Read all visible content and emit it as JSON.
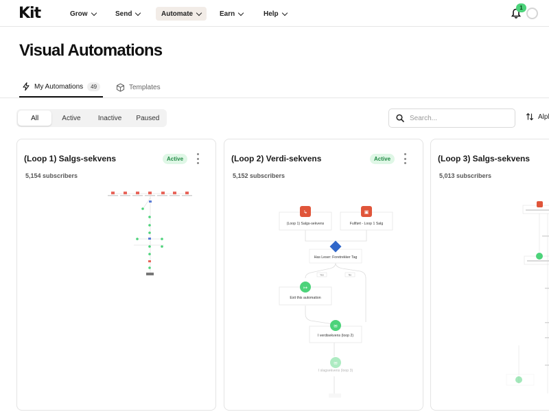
{
  "nav": {
    "logo": "Kit",
    "items": [
      {
        "label": "Grow"
      },
      {
        "label": "Send"
      },
      {
        "label": "Automate"
      },
      {
        "label": "Earn"
      },
      {
        "label": "Help"
      }
    ],
    "notification_count": "1"
  },
  "page": {
    "title": "Visual Automations"
  },
  "tabs": [
    {
      "label": "My Automations",
      "count": "49"
    },
    {
      "label": "Templates"
    }
  ],
  "filters": [
    "All",
    "Active",
    "Inactive",
    "Paused"
  ],
  "search": {
    "placeholder": "Search..."
  },
  "sort": {
    "label": "Alph"
  },
  "colors": {
    "accent_green": "#4cd37a",
    "trigger_red": "#e0553a",
    "badge_bg": "#dff7e6"
  },
  "cards": [
    {
      "title": "(Loop 1) Salgs-sekvens",
      "subscribers": "5,154 subscribers",
      "status": "Active"
    },
    {
      "title": "(Loop 2) Verdi-sekvens",
      "subscribers": "5,152 subscribers",
      "status": "Active",
      "flow": {
        "trigger_1": "(Loop 1) Salgs-sekvens",
        "trigger_2": "Fullført - Loop 1 Salg",
        "condition": "Has Leser: Foretrekker Tag",
        "branch_yes": "Yes",
        "branch_no": "No",
        "exit": "Exit this automation",
        "step_1": "I verdisekvens (loop 2)",
        "step_2": "I slagsekvens (loop 3)"
      }
    },
    {
      "title": "(Loop 3) Salgs-sekvens",
      "subscribers": "5,013 subscribers"
    }
  ]
}
